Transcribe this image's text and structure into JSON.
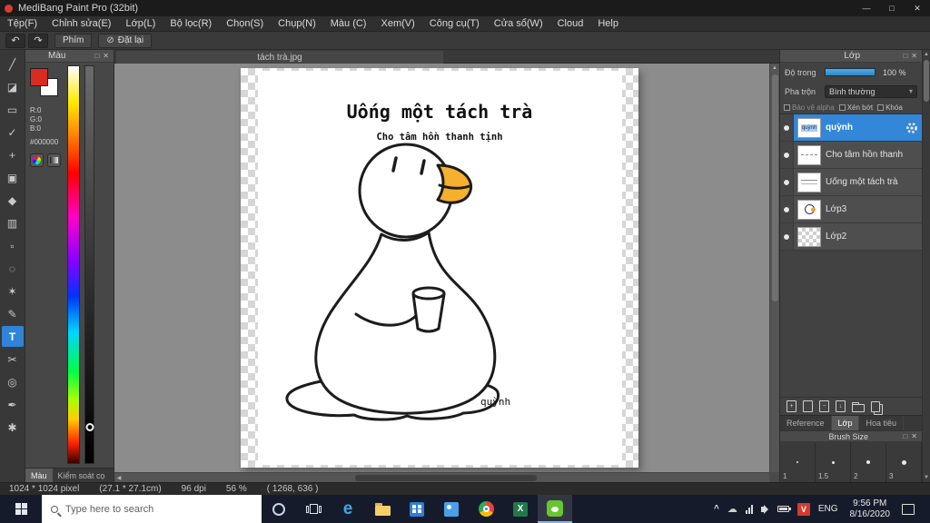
{
  "window": {
    "title": "MediBang Paint Pro (32bit)"
  },
  "icons": {
    "minimize": "—",
    "maximize": "□",
    "close": "✕",
    "undo": "↶",
    "redo": "↷",
    "block": "⊘",
    "up": "▲",
    "down": "▼",
    "left": "◀",
    "right": "▶",
    "popout": "□",
    "dropdown": "▾",
    "chevron_up": "^",
    "cloud": "☁"
  },
  "menu": {
    "items": [
      "Tệp(F)",
      "Chỉnh sửa(E)",
      "Lớp(L)",
      "Bộ lọc(R)",
      "Chọn(S)",
      "Chụp(N)",
      "Màu (C)",
      "Xem(V)",
      "Công cụ(T)",
      "Cửa sổ(W)",
      "Cloud",
      "Help"
    ]
  },
  "toolbar": {
    "phim": "Phím",
    "reset": "Đặt lại"
  },
  "tools": [
    {
      "name": "brush",
      "glyph": "╱"
    },
    {
      "name": "eraser",
      "glyph": "◪"
    },
    {
      "name": "marquee",
      "glyph": "▭"
    },
    {
      "name": "smudge",
      "glyph": "✓"
    },
    {
      "name": "move",
      "glyph": "+"
    },
    {
      "name": "shape-fill",
      "glyph": "▣"
    },
    {
      "name": "bucket",
      "glyph": "◆"
    },
    {
      "name": "gradient",
      "glyph": "▥"
    },
    {
      "name": "select",
      "glyph": "▫"
    },
    {
      "name": "lasso",
      "glyph": "◌"
    },
    {
      "name": "magic-wand",
      "glyph": "✶"
    },
    {
      "name": "select-pen",
      "glyph": "✎"
    },
    {
      "name": "text",
      "glyph": "T"
    },
    {
      "name": "select-eraser",
      "glyph": "✂"
    },
    {
      "name": "eyedropper",
      "glyph": "◎"
    },
    {
      "name": "pen",
      "glyph": "✒"
    },
    {
      "name": "hand",
      "glyph": "✱"
    }
  ],
  "color_panel": {
    "title": "Màu",
    "r": "R:0",
    "g": "G:0",
    "b": "B:0",
    "hex": "#000000",
    "bottom_tabs": [
      "Màu",
      "Kiểm soát cọ"
    ]
  },
  "document": {
    "tab": "tách trà.jpg",
    "artwork": {
      "title": "Uống một tách trà",
      "subtitle": "Cho tâm hồn thanh tịnh",
      "signature": "quỳnh"
    }
  },
  "layers_panel": {
    "title": "Lớp",
    "opacity_label": "Độ trong",
    "opacity_value": "100 %",
    "blend_label": "Pha trộn",
    "blend_value": "Bình thường",
    "options": [
      "Bảo vệ alpha",
      "Xén bớt",
      "Khóa"
    ],
    "layers": [
      {
        "name": "quỳnh"
      },
      {
        "name": "Cho tâm hồn thanh"
      },
      {
        "name": "Uống một tách trà"
      },
      {
        "name": "Lớp3"
      },
      {
        "name": "Lớp2"
      }
    ],
    "tabs": [
      "Reference",
      "Lớp",
      "Hoa tiêu"
    ]
  },
  "brush_panel": {
    "title": "Brush Size",
    "sizes": [
      "1",
      "1.5",
      "2",
      "3"
    ]
  },
  "status": {
    "size": "1024 * 1024 pixel",
    "dimensions": "(27.1 * 27.1cm)",
    "dpi": "96 dpi",
    "zoom": "56 %",
    "coords": "( 1268, 636 )"
  },
  "taskbar": {
    "search": "Type here to search",
    "ime": "V",
    "lang": "ENG",
    "time": "9:56 PM",
    "date": "8/16/2020"
  }
}
